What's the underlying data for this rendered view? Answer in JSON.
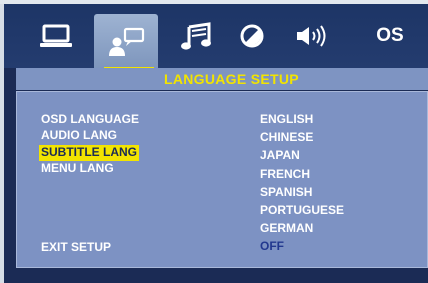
{
  "header": {
    "tabs": [
      {
        "name": "general",
        "icon": "monitor-icon"
      },
      {
        "name": "language",
        "icon": "language-icon",
        "active": true
      },
      {
        "name": "audio",
        "icon": "music-note-icon"
      },
      {
        "name": "video",
        "icon": "contrast-icon"
      },
      {
        "name": "speaker",
        "icon": "speaker-icon"
      },
      {
        "name": "os",
        "label": "OS"
      }
    ]
  },
  "page_title": "LANGUAGE  SETUP",
  "menu": {
    "items": [
      "OSD LANGUAGE",
      "AUDIO LANG",
      "SUBTITLE LANG",
      "MENU LANG"
    ],
    "selected": "SUBTITLE LANG",
    "exit_label": "EXIT SETUP"
  },
  "options": {
    "items": [
      "ENGLISH",
      "CHINESE",
      "JAPAN",
      "FRENCH",
      "SPANISH",
      "PORTUGUESE",
      "GERMAN",
      "OFF"
    ],
    "current": "OFF"
  },
  "colors": {
    "accent": "#f2e400",
    "panel": "#7d92c3",
    "frame": "#1b2b55",
    "current_option": "#22388f"
  }
}
